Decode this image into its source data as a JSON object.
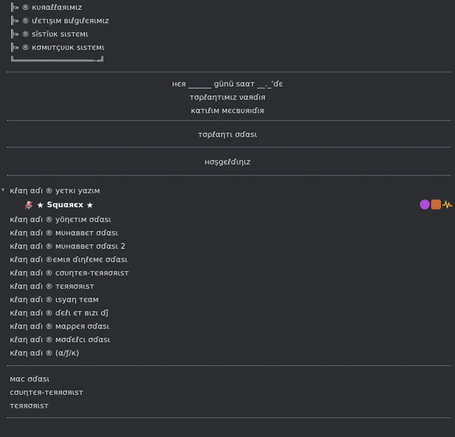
{
  "menu": {
    "items": [
      "╠» ® кυяαℓℓαяιмιz",
      "╠» ® ιℓєтιşιм вιℓgιℓєяιмιz",
      "╠» ® ѕĭѕтĭʋк ѕιѕтємι",
      "╠» ® кσмυтçυʋк ѕιѕтємι"
    ],
    "footer": "╚═════════════════⊸╝"
  },
  "info": {
    "line1": "нєя ______ günü ѕααт __._'ɗє",
    "line2": "тσρℓαηтιмιz ναяɗıя",
    "line3": "кαтιℓιм мєcвυяıɗıя"
  },
  "meeting_room": "тσρℓαηтι σɗαѕι",
  "welcome": "нσşgєℓɗιηιz",
  "auth_channel": "кℓαη αɗı ® уєткı уαzιм",
  "user": {
    "name": "Squαяєх"
  },
  "channels": [
    "кℓαη αɗı ® уöηєтιм σɗαѕι",
    "кℓαη αɗı ® мυнαввєт σɗαѕι",
    "кℓαη αɗı ® мυнαввєт σɗαѕι 2",
    "кℓαη αɗı ®ємιя ɗιηℓємє σɗαѕι",
    "кℓαη αɗı ® cσυηтєя-тєяяσяιѕт",
    "кℓαη αɗı ® тєяяσяιѕт",
    "кℓαη αɗı ® ιѕуαη тєαм",
    "кℓαη αɗı ® ɗєℓι єт вιzι ɗĵ",
    "кℓαη αɗı ® мαρρєя σɗαѕι",
    "кℓαη αɗı ® мσɗєℓcι σɗαѕι",
    "кℓαη αɗı ® (α/ƒ/к)"
  ],
  "bottom_channels": [
    "мαc σɗαѕι",
    "cσυηтєя-тєяяσяιѕт",
    "тєяяσяιѕт"
  ]
}
